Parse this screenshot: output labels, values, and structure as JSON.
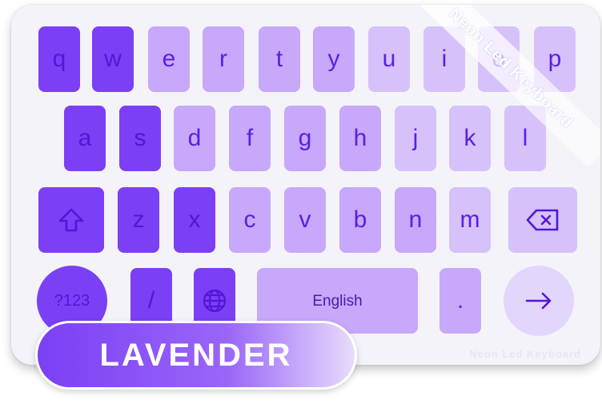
{
  "keyboard": {
    "row1": [
      "q",
      "w",
      "e",
      "r",
      "t",
      "y",
      "u",
      "i",
      "o",
      "p"
    ],
    "row2": [
      "a",
      "s",
      "d",
      "f",
      "g",
      "h",
      "j",
      "k",
      "l"
    ],
    "row3": [
      "z",
      "x",
      "c",
      "v",
      "b",
      "n",
      "m"
    ],
    "symbols_label": "?123",
    "slash_label": "/",
    "space_label": "English",
    "period_label": ".",
    "shift_icon": "shift-arrow-icon",
    "backspace_icon": "backspace-icon",
    "globe_icon": "globe-icon",
    "enter_icon": "arrow-right-icon"
  },
  "branding": {
    "banner_text": "Neon Led Keyboard",
    "watermark_text": "Neon Led Keyboard"
  },
  "theme": {
    "name": "LAVENDER",
    "accent": "#7b3ff5"
  }
}
